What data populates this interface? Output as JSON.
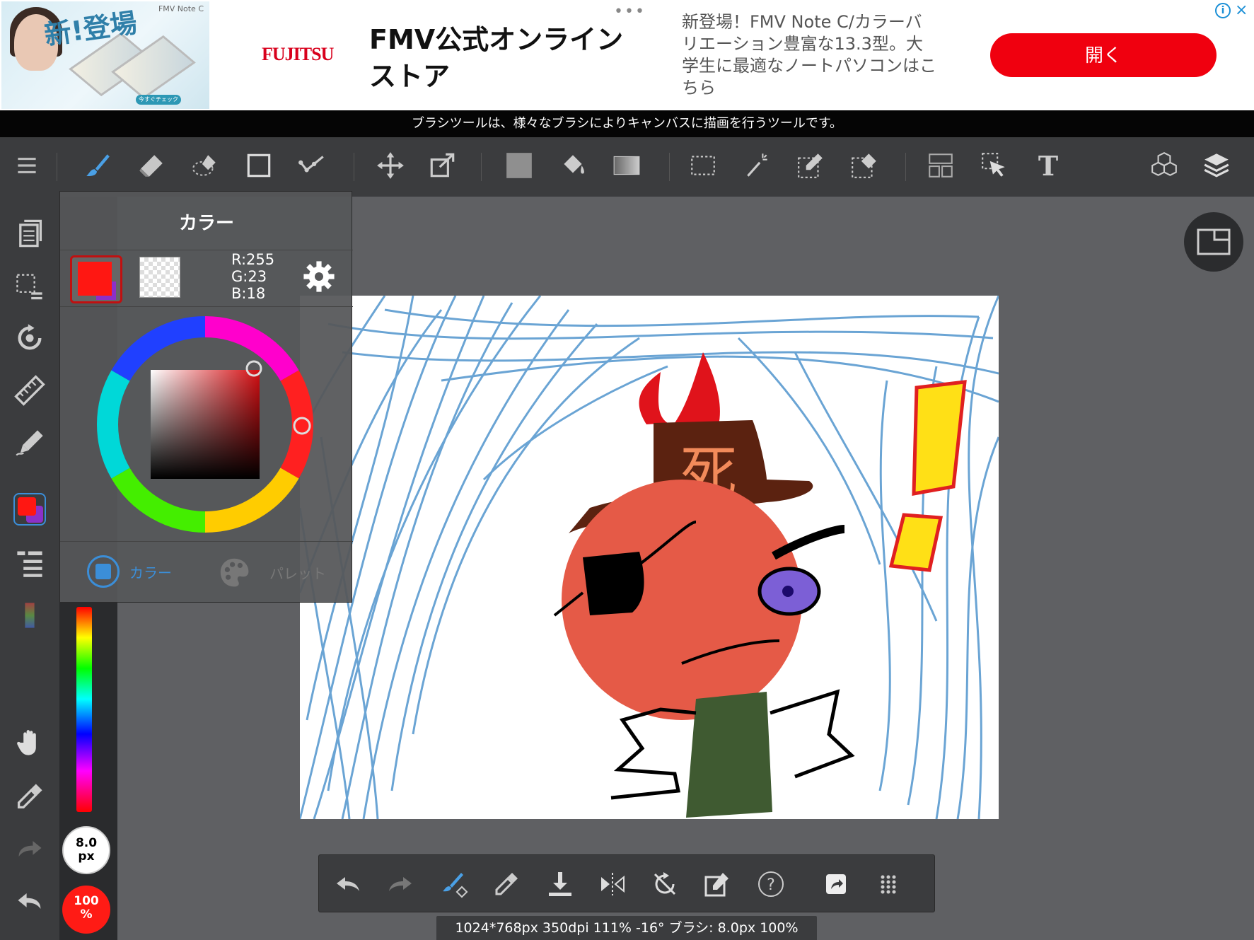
{
  "ad": {
    "image_headline": "新!登場",
    "image_brand": "FMV Note C",
    "image_button": "今すぐチェック",
    "logo": "FUJITSU",
    "title": "FMV公式オンラインストア",
    "description": "新登場！FMV Note C/カラーバリエーション豊富な13.3型。大学生に最適なノートパソコンはこちら",
    "open_button": "開く",
    "info_label": "i",
    "close_label": "×"
  },
  "hint_bar": {
    "text": "ブラシツールは、様々なブラシによりキャンバスに描画を行うツールです。"
  },
  "top_toolbar": {
    "tools": [
      "menu",
      "brush",
      "eraser",
      "lasso-eraser",
      "rectangle",
      "polyline",
      "move",
      "transform",
      "fill-color",
      "bucket",
      "gradient",
      "select",
      "magic-wand",
      "select-pen",
      "select-eraser",
      "frame",
      "select-cursor",
      "text",
      "3d",
      "layers"
    ],
    "text_tool_label": "T"
  },
  "sidebar": {
    "items": [
      "pages",
      "selection-list",
      "rotate",
      "ruler",
      "pen-style",
      "color",
      "list",
      "gradient-swatch",
      "hand",
      "eyedropper",
      "redo",
      "undo"
    ]
  },
  "brush": {
    "size_value": "8.0",
    "size_unit": "px",
    "opacity_value": "100",
    "opacity_unit": "%"
  },
  "color_panel": {
    "title": "カラー",
    "rgb": {
      "r": "R:255",
      "g": "G:23",
      "b": "B:18"
    },
    "current_color": "#ff1712",
    "secondary_color": "#8c30c8",
    "tab_color_label": "カラー",
    "tab_palette_label": "パレット"
  },
  "canvas": {
    "hat_text": "死"
  },
  "bottom_toolbar": {
    "tools": [
      "undo",
      "redo",
      "brush-settings",
      "eyedropper",
      "download",
      "flip",
      "rotate-reset",
      "edit",
      "help",
      "share",
      "more"
    ]
  },
  "status": {
    "text": "1024*768px 350dpi 111% -16° ブラシ: 8.0px 100%"
  }
}
